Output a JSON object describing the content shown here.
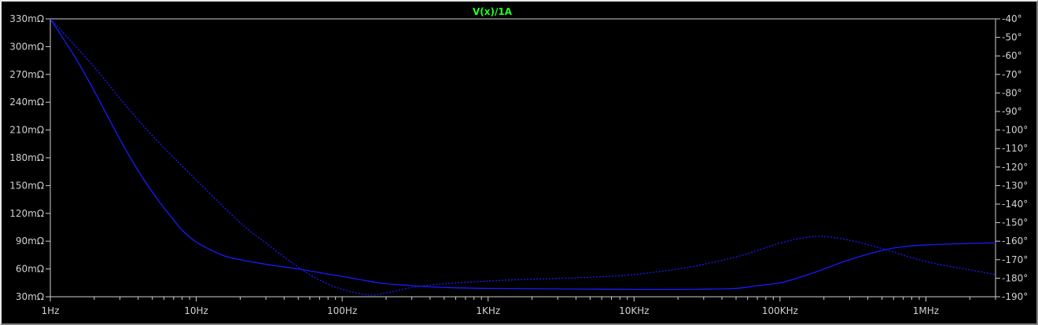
{
  "chart_data": {
    "type": "line",
    "title": "V(x)/1A",
    "title_color": "#22ff22",
    "background": "#000000",
    "trace_color": "#1a1aff",
    "axis_color": "#d0d0d0",
    "x_scale": "log",
    "x_range": [
      1,
      3000000
    ],
    "x_ticks": [
      {
        "value": 1,
        "label": "1Hz"
      },
      {
        "value": 10,
        "label": "10Hz"
      },
      {
        "value": 100,
        "label": "100Hz"
      },
      {
        "value": 1000,
        "label": "1KHz"
      },
      {
        "value": 10000,
        "label": "10KHz"
      },
      {
        "value": 100000,
        "label": "100KHz"
      },
      {
        "value": 1000000,
        "label": "1MHz"
      }
    ],
    "y_left": {
      "unit": "mΩ",
      "range": [
        30,
        330
      ],
      "ticks": [
        {
          "value": 30,
          "label": "30mΩ"
        },
        {
          "value": 60,
          "label": "60mΩ"
        },
        {
          "value": 90,
          "label": "90mΩ"
        },
        {
          "value": 120,
          "label": "120mΩ"
        },
        {
          "value": 150,
          "label": "150mΩ"
        },
        {
          "value": 180,
          "label": "180mΩ"
        },
        {
          "value": 210,
          "label": "210mΩ"
        },
        {
          "value": 240,
          "label": "240mΩ"
        },
        {
          "value": 270,
          "label": "270mΩ"
        },
        {
          "value": 300,
          "label": "300mΩ"
        },
        {
          "value": 330,
          "label": "330mΩ"
        }
      ]
    },
    "y_right": {
      "unit": "°",
      "range": [
        -190,
        -40
      ],
      "ticks": [
        {
          "value": -40,
          "label": "-40°"
        },
        {
          "value": -50,
          "label": "-50°"
        },
        {
          "value": -60,
          "label": "-60°"
        },
        {
          "value": -70,
          "label": "-70°"
        },
        {
          "value": -80,
          "label": "-80°"
        },
        {
          "value": -90,
          "label": "-90°"
        },
        {
          "value": -100,
          "label": "-100°"
        },
        {
          "value": -110,
          "label": "-110°"
        },
        {
          "value": -120,
          "label": "-120°"
        },
        {
          "value": -130,
          "label": "-130°"
        },
        {
          "value": -140,
          "label": "-140°"
        },
        {
          "value": -150,
          "label": "-150°"
        },
        {
          "value": -160,
          "label": "-160°"
        },
        {
          "value": -170,
          "label": "-170°"
        },
        {
          "value": -180,
          "label": "-180°"
        },
        {
          "value": -190,
          "label": "-190°"
        }
      ]
    },
    "series": [
      {
        "axis": "left",
        "dash": false,
        "points": [
          [
            1,
            330
          ],
          [
            1.5,
            287
          ],
          [
            2,
            252
          ],
          [
            3,
            200
          ],
          [
            4,
            166
          ],
          [
            5,
            143
          ],
          [
            6,
            126
          ],
          [
            7,
            113
          ],
          [
            8,
            102
          ],
          [
            10,
            89
          ],
          [
            15,
            75
          ],
          [
            20,
            70
          ],
          [
            30,
            65
          ],
          [
            50,
            60
          ],
          [
            70,
            56
          ],
          [
            100,
            52
          ],
          [
            150,
            47
          ],
          [
            200,
            44
          ],
          [
            300,
            42
          ],
          [
            500,
            40
          ],
          [
            1000,
            39
          ],
          [
            3000,
            38.5
          ],
          [
            10000,
            38
          ],
          [
            20000,
            38
          ],
          [
            30000,
            38.2
          ],
          [
            50000,
            39
          ],
          [
            70000,
            42
          ],
          [
            100000,
            45
          ],
          [
            150000,
            53
          ],
          [
            200000,
            60
          ],
          [
            300000,
            70
          ],
          [
            500000,
            80
          ],
          [
            700000,
            84
          ],
          [
            1000000,
            86
          ],
          [
            2000000,
            87.5
          ],
          [
            3000000,
            88
          ]
        ]
      },
      {
        "axis": "right",
        "dash": true,
        "points": [
          [
            1,
            -40
          ],
          [
            2,
            -66
          ],
          [
            3,
            -83
          ],
          [
            5,
            -103
          ],
          [
            10,
            -127
          ],
          [
            20,
            -150
          ],
          [
            30,
            -161
          ],
          [
            50,
            -174
          ],
          [
            70,
            -181
          ],
          [
            100,
            -186
          ],
          [
            150,
            -189
          ],
          [
            200,
            -188
          ],
          [
            300,
            -185
          ],
          [
            500,
            -183
          ],
          [
            1000,
            -181.5
          ],
          [
            2000,
            -180.5
          ],
          [
            5000,
            -179.5
          ],
          [
            10000,
            -178
          ],
          [
            20000,
            -175
          ],
          [
            30000,
            -172.5
          ],
          [
            50000,
            -168.5
          ],
          [
            70000,
            -165
          ],
          [
            100000,
            -161
          ],
          [
            150000,
            -158
          ],
          [
            200000,
            -157.5
          ],
          [
            300000,
            -159.5
          ],
          [
            500000,
            -164
          ],
          [
            1000000,
            -171
          ],
          [
            2000000,
            -175.5
          ],
          [
            3000000,
            -178
          ]
        ]
      }
    ]
  }
}
